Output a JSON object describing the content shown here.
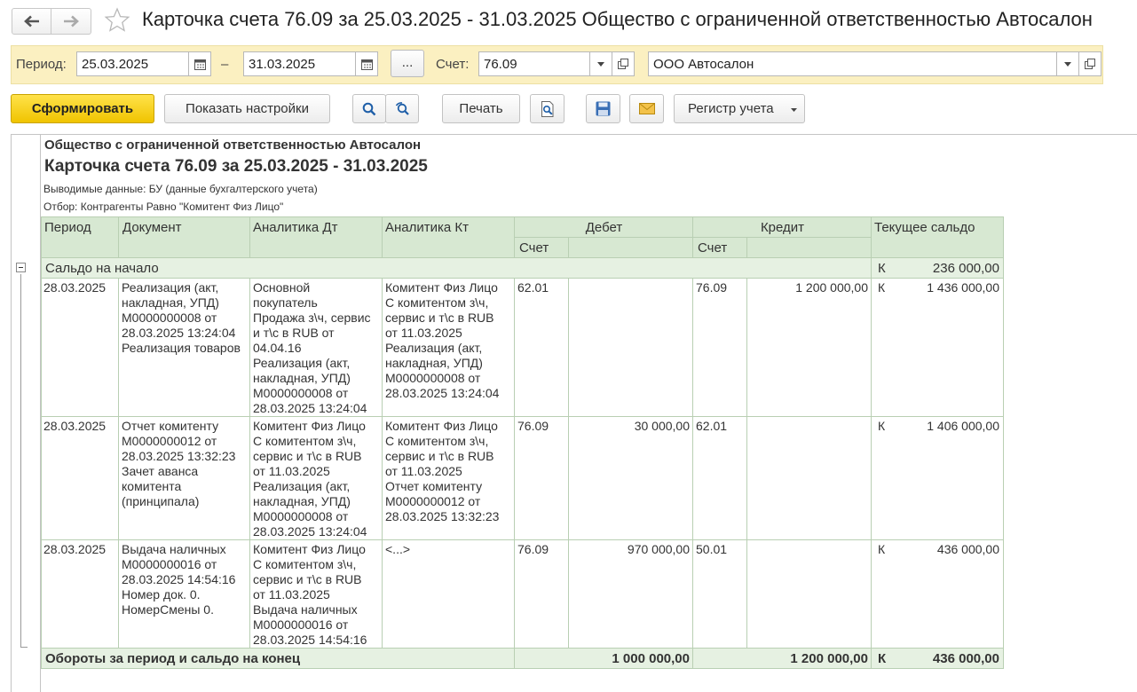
{
  "window": {
    "title": "Карточка счета 76.09 за 25.03.2025 - 31.03.2025 Общество с ограниченной ответственностью Автосалон"
  },
  "params": {
    "period_label": "Период:",
    "date_from": "25.03.2025",
    "dash": "–",
    "date_to": "31.03.2025",
    "ellipsis": "...",
    "account_label": "Счет:",
    "account": "76.09",
    "organization": "ООО Автосалон"
  },
  "toolbar": {
    "generate": "Сформировать",
    "show_settings": "Показать настройки",
    "print": "Печать",
    "register": "Регистр учета"
  },
  "report": {
    "org": "Общество с ограниченной ответственностью Автосалон",
    "title": "Карточка счета 76.09 за 25.03.2025 - 31.03.2025",
    "output_data": "Выводимые данные: БУ (данные бухгалтерского учета)",
    "filter": "Отбор: Контрагенты Равно \"Комитент Физ Лицо\"",
    "headers": {
      "period": "Период",
      "document": "Документ",
      "analytics_dt": "Аналитика Дт",
      "analytics_kt": "Аналитика Кт",
      "debit": "Дебет",
      "credit": "Кредит",
      "balance": "Текущее сальдо",
      "account_dt": "Счет",
      "account_kt": "Счет"
    },
    "opening": {
      "label": "Сальдо на начало",
      "dir": "К",
      "balance": "236 000,00"
    },
    "rows": [
      {
        "period": "28.03.2025",
        "document": "Реализация (акт,\nнакладная, УПД)\nМ0000000008 от\n28.03.2025 13:24:04\nРеализация товаров",
        "analytics_dt": "Основной\nпокупатель\nПродажа з\\ч, сервис\nи т\\с в RUB от\n04.04.16\nРеализация (акт,\nнакладная, УПД)\nМ0000000008 от\n28.03.2025 13:24:04",
        "analytics_kt": "Комитент Физ Лицо\nС комитентом з\\ч,\nсервис и т\\с в RUB\nот 11.03.2025\nРеализация (акт,\nнакладная, УПД)\nМ0000000008 от\n28.03.2025 13:24:04",
        "acc_dt": "62.01",
        "sum_dt": "",
        "acc_kt": "76.09",
        "sum_kt": "1 200 000,00",
        "dir": "К",
        "balance": "1 436 000,00"
      },
      {
        "period": "28.03.2025",
        "document": "Отчет комитенту\nМ0000000012 от\n28.03.2025 13:32:23\nЗачет аванса\nкомитента\n(принципала)",
        "analytics_dt": "Комитент Физ Лицо\nС комитентом з\\ч,\nсервис и т\\с в RUB\nот 11.03.2025\nРеализация (акт,\nнакладная, УПД)\nМ0000000008 от\n28.03.2025 13:24:04",
        "analytics_kt": "Комитент Физ Лицо\nС комитентом з\\ч,\nсервис и т\\с в RUB\nот 11.03.2025\nОтчет комитенту\nМ0000000012 от\n28.03.2025 13:32:23",
        "acc_dt": "76.09",
        "sum_dt": "30 000,00",
        "acc_kt": "62.01",
        "sum_kt": "",
        "dir": "К",
        "balance": "1 406 000,00"
      },
      {
        "period": "28.03.2025",
        "document": "Выдача наличных\nМ0000000016 от\n28.03.2025 14:54:16\nНомер док.  0.\nНомерСмены 0.",
        "analytics_dt": "Комитент Физ Лицо\nС комитентом з\\ч,\nсервис и т\\с в RUB\nот 11.03.2025\nВыдача наличных\nМ0000000016 от\n28.03.2025 14:54:16",
        "analytics_kt": "<...>",
        "acc_dt": "76.09",
        "sum_dt": "970 000,00",
        "acc_kt": "50.01",
        "sum_kt": "",
        "dir": "К",
        "balance": "436 000,00"
      }
    ],
    "totals": {
      "label": "Обороты за период и сальдо на конец",
      "debit": "1 000 000,00",
      "credit": "1 200 000,00",
      "dir": "К",
      "balance": "436 000,00"
    }
  }
}
